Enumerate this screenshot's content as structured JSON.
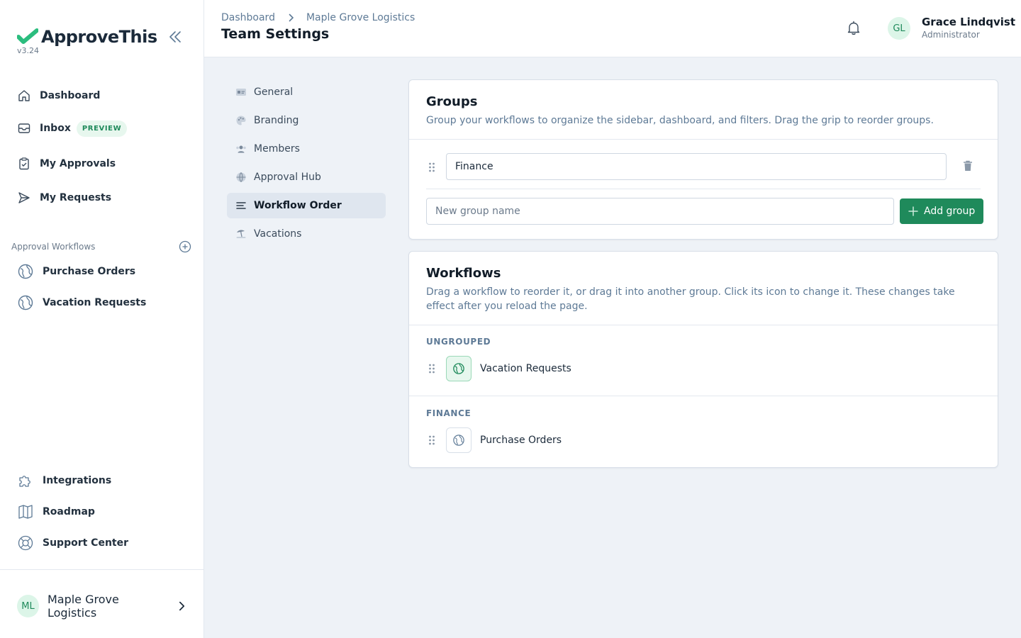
{
  "brand": {
    "name": "ApproveThis",
    "version": "v3.24"
  },
  "sidebar": {
    "nav": [
      {
        "label": "Dashboard",
        "icon": "home-icon"
      },
      {
        "label": "Inbox",
        "icon": "inbox-icon",
        "badge": "PREVIEW"
      },
      {
        "label": "My Approvals",
        "icon": "clipboard-check-icon"
      },
      {
        "label": "My Requests",
        "icon": "send-icon"
      }
    ],
    "workflows_label": "Approval Workflows",
    "workflows": [
      {
        "label": "Purchase Orders",
        "icon": "globe-icon"
      },
      {
        "label": "Vacation Requests",
        "icon": "globe-icon"
      }
    ],
    "footer_links": [
      {
        "label": "Integrations",
        "icon": "puzzle-icon"
      },
      {
        "label": "Roadmap",
        "icon": "map-icon"
      },
      {
        "label": "Support Center",
        "icon": "lifebuoy-icon"
      }
    ],
    "org": {
      "initials": "ML",
      "name": "Maple Grove Logistics"
    }
  },
  "header": {
    "breadcrumbs": [
      "Dashboard",
      "Maple Grove Logistics"
    ],
    "title": "Team Settings",
    "user": {
      "initials": "GL",
      "name": "Grace Lindqvist",
      "role": "Administrator"
    }
  },
  "settings_nav": [
    {
      "label": "General",
      "icon": "id-card-icon",
      "active": false
    },
    {
      "label": "Branding",
      "icon": "palette-icon",
      "active": false
    },
    {
      "label": "Members",
      "icon": "users-icon",
      "active": false
    },
    {
      "label": "Approval Hub",
      "icon": "globe-icon",
      "active": false
    },
    {
      "label": "Workflow Order",
      "icon": "list-icon",
      "active": true
    },
    {
      "label": "Vacations",
      "icon": "umbrella-beach-icon",
      "active": false
    }
  ],
  "groups_card": {
    "title": "Groups",
    "description": "Group your workflows to organize the sidebar, dashboard, and filters. Drag the grip to reorder groups.",
    "groups": [
      {
        "name": "Finance"
      }
    ],
    "new_group_placeholder": "New group name",
    "add_button": "Add group"
  },
  "workflows_card": {
    "title": "Workflows",
    "description": "Drag a workflow to reorder it, or drag it into another group. Click its icon to change it. These changes take effect after you reload the page.",
    "sections": [
      {
        "label": "UNGROUPED",
        "items": [
          {
            "name": "Vacation Requests",
            "icon": "globe-icon"
          }
        ]
      },
      {
        "label": "FINANCE",
        "items": [
          {
            "name": "Purchase Orders",
            "icon": "globe-icon"
          }
        ]
      }
    ]
  },
  "colors": {
    "accent": "#1f8a5b",
    "accent_light": "#e7f7ee",
    "muted": "#5e7a96"
  }
}
